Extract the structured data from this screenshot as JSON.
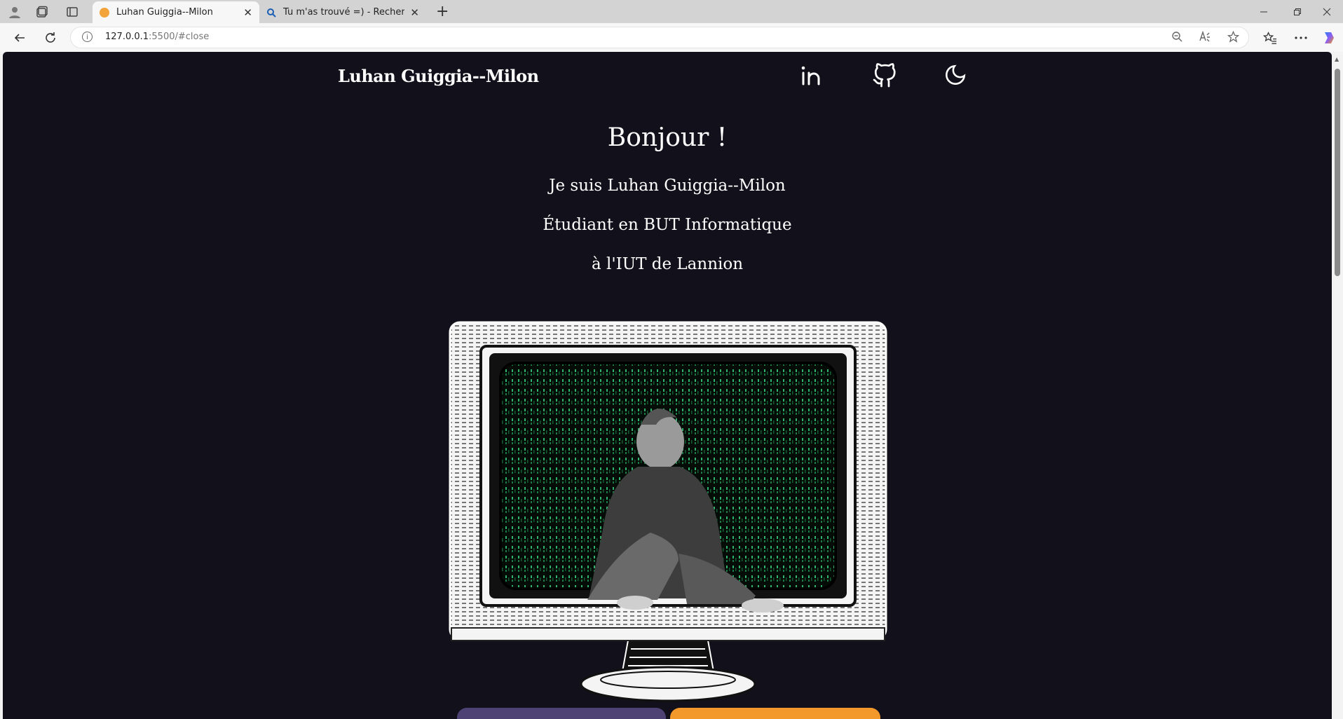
{
  "browser": {
    "tabs": [
      {
        "title": "Luhan Guiggia--Milon",
        "active": true
      },
      {
        "title": "Tu m'as trouvé =) - Recherche",
        "active": false
      }
    ],
    "url_host": "127.0.0.1",
    "url_rest": ":5500/#close",
    "new_tab": "+",
    "close": "✕"
  },
  "site": {
    "brand": "Luhan Guiggia--Milon",
    "nav": [
      {
        "icon": "linkedin-icon"
      },
      {
        "icon": "github-icon"
      },
      {
        "icon": "moon-icon"
      }
    ]
  },
  "hero": {
    "title": "Bonjour !",
    "line1": "Je suis Luhan Guiggia--Milon",
    "line2": "Étudiant en BUT Informatique",
    "line3": "à l'IUT de Lannion"
  },
  "colors": {
    "page_bg": "#12111b",
    "button_purple": "#4e4275",
    "button_orange": "#f3982a",
    "matrix_green": "#2fb36a"
  }
}
